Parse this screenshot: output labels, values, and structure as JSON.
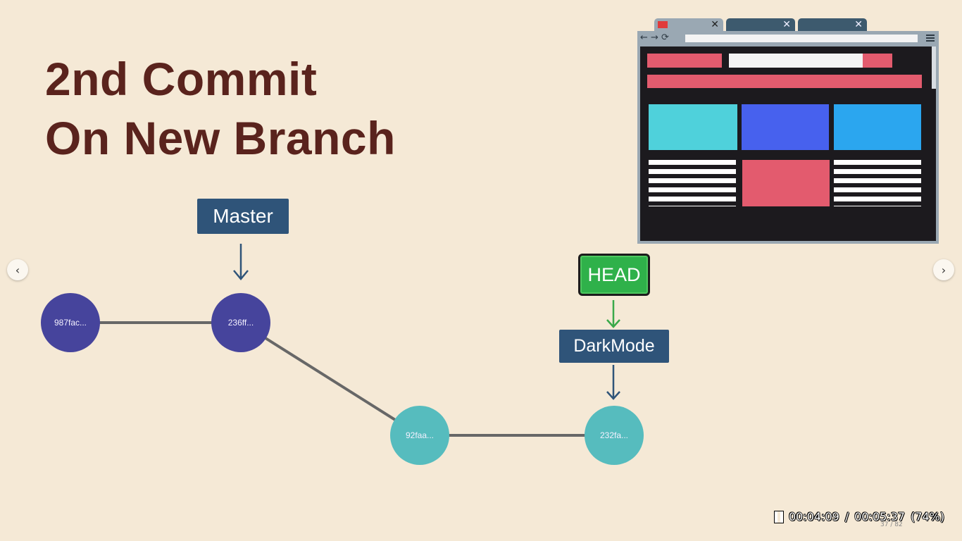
{
  "slide": {
    "title_line1": "2nd Commit",
    "title_line2": "On New Branch"
  },
  "graph": {
    "commits": [
      {
        "id": "987fac...",
        "branch": "master"
      },
      {
        "id": "236ff...",
        "branch": "master"
      },
      {
        "id": "92faa...",
        "branch": "darkmode"
      },
      {
        "id": "232fa...",
        "branch": "darkmode"
      }
    ],
    "labels": {
      "master": "Master",
      "head": "HEAD",
      "darkmode": "DarkMode"
    },
    "colors": {
      "master_commit": "#46449c",
      "branch_commit": "#56bcbe",
      "branch_label": "#2f5479",
      "head": "#2fb14a",
      "edge": "#676767"
    }
  },
  "browser_illustration": {
    "colors": {
      "pink": "#e35b6e",
      "cyan": "#4fd1db",
      "blue": "#4761ee",
      "sky": "#2ba6ef"
    }
  },
  "navigation": {
    "prev_icon": "chevron-left-icon",
    "next_icon": "chevron-right-icon"
  },
  "player": {
    "current_time": "00:04:09",
    "separator": "/",
    "total_time": "00:05:37",
    "percent": "(74%)",
    "page_counter": "37 / 82"
  }
}
